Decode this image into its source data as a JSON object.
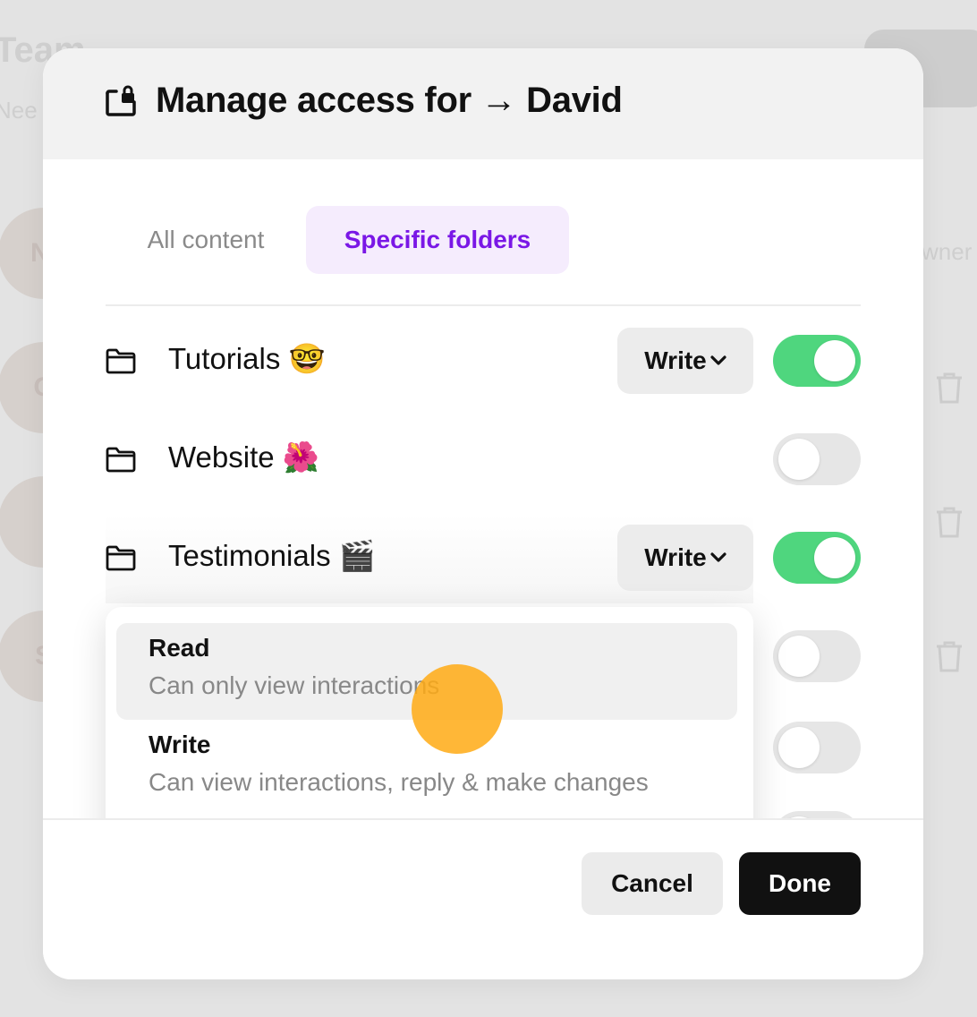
{
  "background": {
    "page_title": "Team",
    "page_subtitle": "Nee",
    "avatars": [
      "NI",
      "G",
      "",
      "S"
    ],
    "owner_label": "wner"
  },
  "modal": {
    "title": "Manage access for → David",
    "tabs": {
      "all_content": "All content",
      "specific_folders": "Specific folders",
      "active": "specific_folders"
    },
    "folders": [
      {
        "name": "Tutorials 🤓",
        "permission": "Write",
        "enabled": true
      },
      {
        "name": "Website 🌺",
        "permission": "",
        "enabled": false
      },
      {
        "name": "Testimonials 🎬",
        "permission": "Write",
        "enabled": true
      },
      {
        "name": "",
        "permission": "",
        "enabled": false
      },
      {
        "name": "",
        "permission": "",
        "enabled": false
      }
    ],
    "dropdown": {
      "options": [
        {
          "title": "Read",
          "description": "Can only view interactions",
          "hovered": true
        },
        {
          "title": "Write",
          "description": "Can view interactions, reply & make changes",
          "hovered": false
        }
      ]
    },
    "cancel_label": "Cancel",
    "done_label": "Done"
  },
  "colors": {
    "accent_purple": "#7a17e6",
    "toggle_on": "#4fd67e",
    "cursor": "#ffaa14"
  }
}
